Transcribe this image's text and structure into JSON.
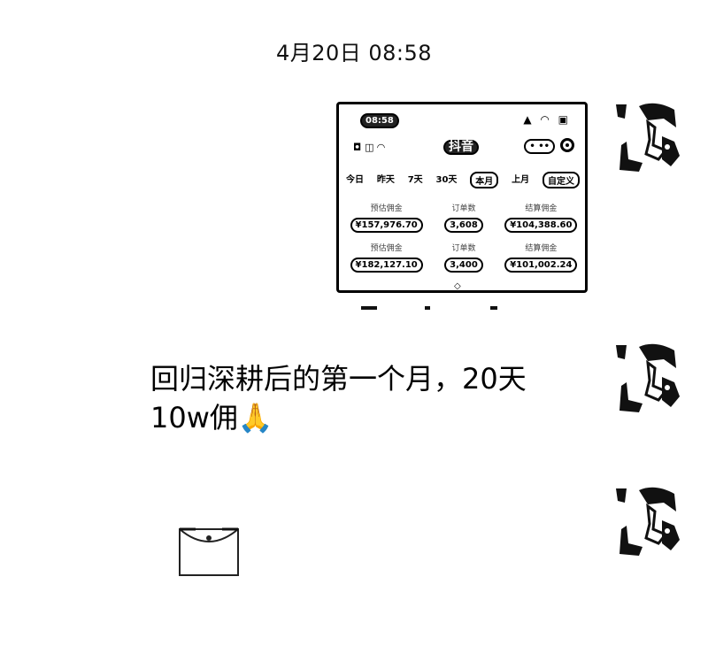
{
  "chat": {
    "timestamp": "4月20日 08:58",
    "messages": [
      {
        "type": "image",
        "screenshot": {
          "status_time": "08:58",
          "status_icons": "▲ ◠ ▣",
          "header_left": "◘ ◫ ◠",
          "app_title": "抖音",
          "tabs": [
            "今日",
            "昨天",
            "7天",
            "30天",
            "本月",
            "上月",
            "自定义"
          ],
          "stats": [
            {
              "label": "预估佣金",
              "value": "¥157,976.70"
            },
            {
              "label": "订单数",
              "value": "3,608"
            },
            {
              "label": "结算佣金",
              "value": "¥104,388.60"
            },
            {
              "label": "预估佣金",
              "value": "¥182,127.10"
            },
            {
              "label": "订单数",
              "value": "3,400"
            },
            {
              "label": "结算佣金",
              "value": "¥101,002.24"
            }
          ]
        }
      },
      {
        "type": "text",
        "text": "回归深耕后的第一个月，20天10w佣🙏"
      },
      {
        "type": "red-packet"
      }
    ]
  }
}
